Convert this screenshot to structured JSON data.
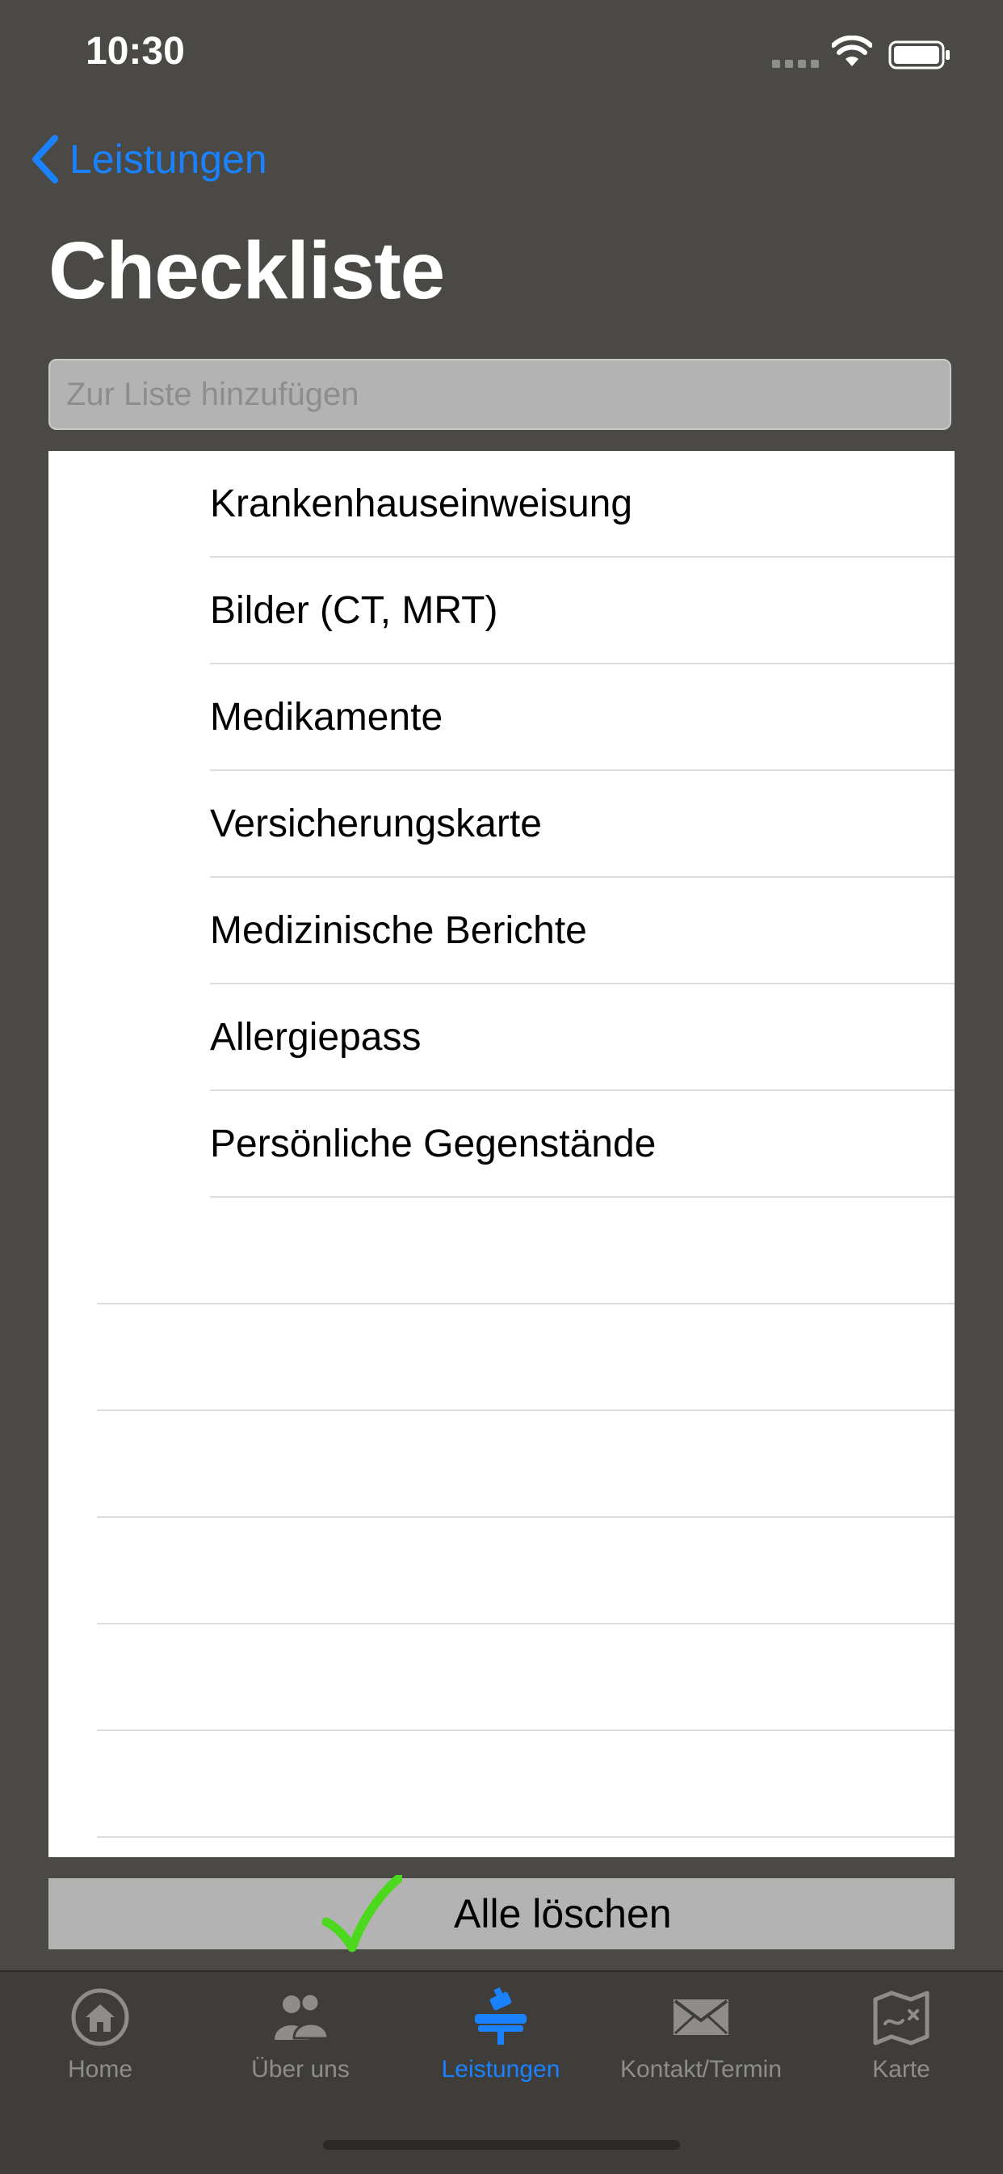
{
  "status_bar": {
    "time": "10:30"
  },
  "nav": {
    "back_label": "Leistungen",
    "title": "Checkliste"
  },
  "add_field": {
    "placeholder": "Zur Liste hinzufügen",
    "value": ""
  },
  "checklist": {
    "items": [
      {
        "label": "Krankenhauseinweisung"
      },
      {
        "label": "Bilder (CT, MRT)"
      },
      {
        "label": "Medikamente"
      },
      {
        "label": "Versicherungskarte"
      },
      {
        "label": "Medizinische Berichte"
      },
      {
        "label": "Allergiepass"
      },
      {
        "label": "Persönliche Gegenstände"
      }
    ]
  },
  "clear_button": {
    "label": "Alle löschen",
    "icon": "checkmark-icon",
    "icon_color": "#4cd81c"
  },
  "tab_bar": {
    "tabs": [
      {
        "label": "Home",
        "icon": "home-icon",
        "active": false
      },
      {
        "label": "Über uns",
        "icon": "people-icon",
        "active": false
      },
      {
        "label": "Leistungen",
        "icon": "services-icon",
        "active": true
      },
      {
        "label": "Kontakt/Termin",
        "icon": "envelope-icon",
        "active": false
      },
      {
        "label": "Karte",
        "icon": "map-icon",
        "active": false
      }
    ],
    "active_color": "#1a82ff",
    "inactive_color": "#8e8d8b"
  },
  "colors": {
    "accent": "#1a82ff",
    "background": "#4a4945"
  }
}
